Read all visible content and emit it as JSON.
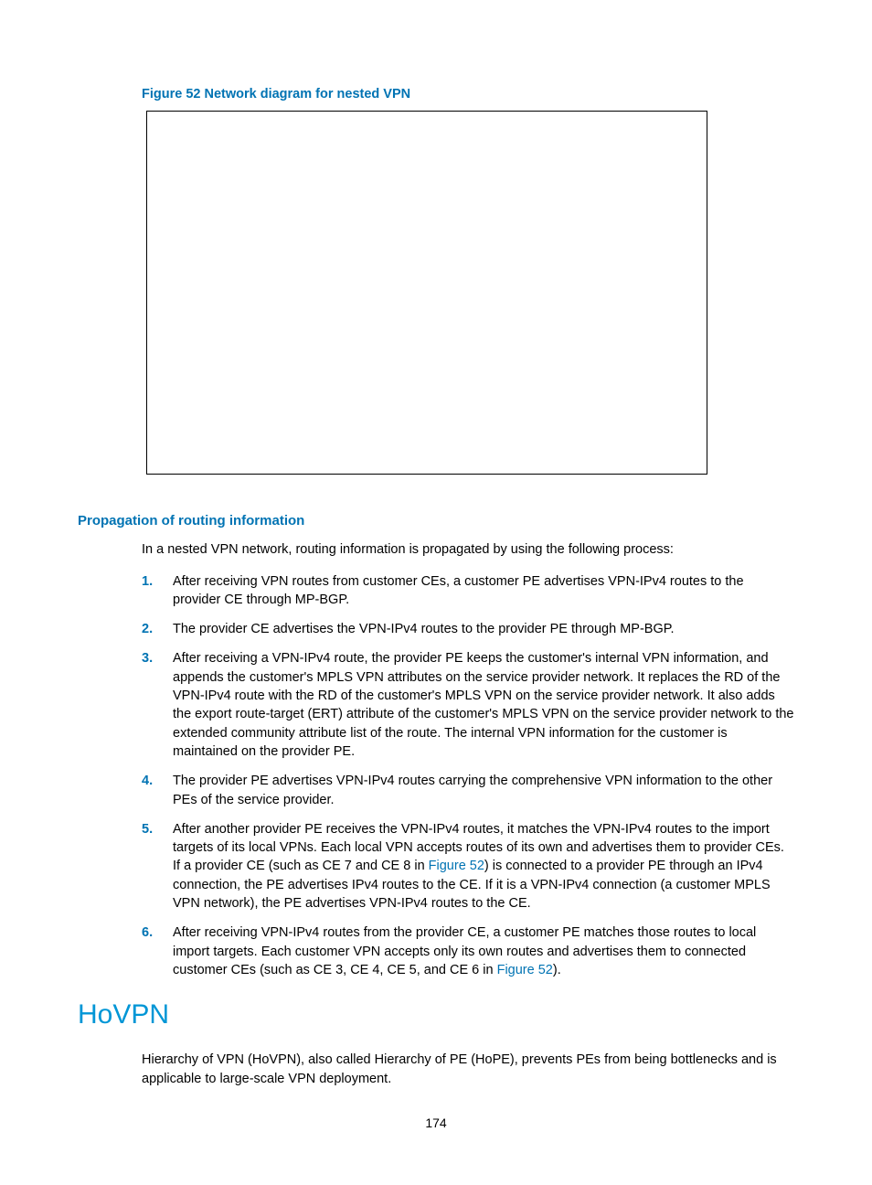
{
  "figure": {
    "caption": "Figure 52 Network diagram for nested VPN"
  },
  "subsection": {
    "heading": "Propagation of routing information",
    "intro": "In a nested VPN network, routing information is propagated by using the following process:"
  },
  "steps": [
    {
      "num": "1.",
      "text": "After receiving VPN routes from customer CEs, a customer PE advertises VPN-IPv4 routes to the provider CE through MP-BGP."
    },
    {
      "num": "2.",
      "text": "The provider CE advertises the VPN-IPv4 routes to the provider PE through MP-BGP."
    },
    {
      "num": "3.",
      "text": "After receiving a VPN-IPv4 route, the provider PE keeps the customer's internal VPN information, and appends the customer's MPLS VPN attributes on the service provider network. It replaces the RD of the VPN-IPv4 route with the RD of the customer's MPLS VPN on the service provider network. It also adds the export route-target (ERT) attribute of the customer's MPLS VPN on the service provider network to the extended community attribute list of the route. The internal VPN information for the customer is maintained on the provider PE."
    },
    {
      "num": "4.",
      "text": "The provider PE advertises VPN-IPv4 routes carrying the comprehensive VPN information to the other PEs of the service provider."
    },
    {
      "num": "5.",
      "pre": "After another provider PE receives the VPN-IPv4 routes, it matches the VPN-IPv4 routes to the import targets of its local VPNs. Each local VPN accepts routes of its own and advertises them to provider CEs. If a provider CE (such as CE 7 and CE 8 in ",
      "link": "Figure 52",
      "post": ") is connected to a provider PE through an IPv4 connection, the PE advertises IPv4 routes to the CE. If it is a VPN-IPv4 connection (a customer MPLS VPN network), the PE advertises VPN-IPv4 routes to the CE."
    },
    {
      "num": "6.",
      "pre": "After receiving VPN-IPv4 routes from the provider CE, a customer PE matches those routes to local import targets. Each customer VPN accepts only its own routes and advertises them to connected customer CEs (such as CE 3, CE 4, CE 5, and CE 6 in ",
      "link": "Figure 52",
      "post": ")."
    }
  ],
  "section": {
    "heading": "HoVPN",
    "body": "Hierarchy of VPN (HoVPN), also called Hierarchy of PE (HoPE), prevents PEs from being bottlenecks and is applicable to large-scale VPN deployment."
  },
  "pageNumber": "174"
}
